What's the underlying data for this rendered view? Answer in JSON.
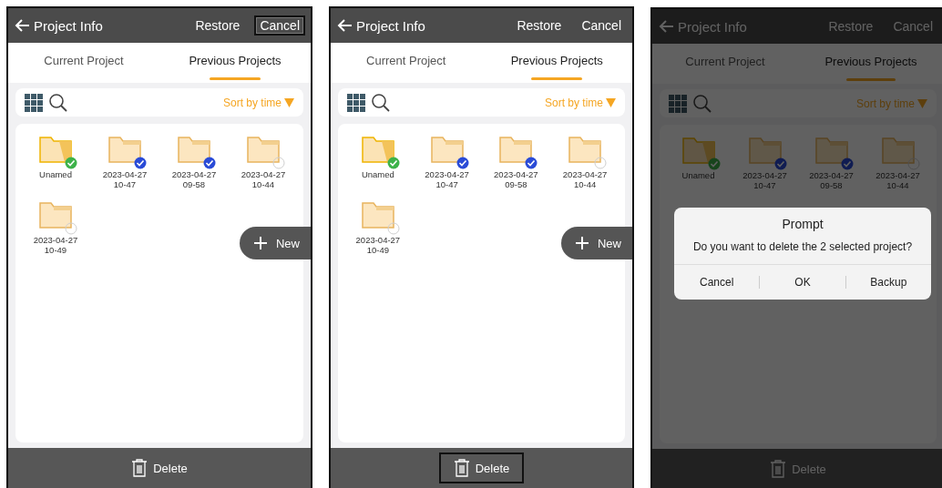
{
  "screens": [
    {
      "dimmed": false,
      "header": {
        "title": "Project Info",
        "actions": [
          {
            "label": "Restore",
            "highlighted": false
          },
          {
            "label": "Cancel",
            "highlighted": true
          }
        ]
      },
      "tabs": [
        {
          "label": "Current Project",
          "selected": false
        },
        {
          "label": "Previous Projects",
          "selected": true
        }
      ],
      "sort": "Sort by time",
      "projects": [
        {
          "lines": [
            "Unamed"
          ],
          "current": true,
          "checked": true
        },
        {
          "lines": [
            "2023-04-27",
            "10-47"
          ],
          "current": false,
          "checked": true
        },
        {
          "lines": [
            "2023-04-27",
            "09-58"
          ],
          "current": false,
          "checked": true
        },
        {
          "lines": [
            "2023-04-27",
            "10-44"
          ],
          "current": false,
          "checked": false
        },
        {
          "lines": [
            "2023-04-27",
            "10-49"
          ],
          "current": false,
          "checked": false
        }
      ],
      "new_button": "New",
      "delete_button": {
        "label": "Delete",
        "highlighted": false
      }
    },
    {
      "dimmed": false,
      "header": {
        "title": "Project Info",
        "actions": [
          {
            "label": "Restore",
            "highlighted": false
          },
          {
            "label": "Cancel",
            "highlighted": false
          }
        ]
      },
      "tabs": [
        {
          "label": "Current Project",
          "selected": false
        },
        {
          "label": "Previous Projects",
          "selected": true
        }
      ],
      "sort": "Sort by time",
      "projects": [
        {
          "lines": [
            "Unamed"
          ],
          "current": true,
          "checked": true
        },
        {
          "lines": [
            "2023-04-27",
            "10-47"
          ],
          "current": false,
          "checked": true
        },
        {
          "lines": [
            "2023-04-27",
            "09-58"
          ],
          "current": false,
          "checked": true
        },
        {
          "lines": [
            "2023-04-27",
            "10-44"
          ],
          "current": false,
          "checked": false
        },
        {
          "lines": [
            "2023-04-27",
            "10-49"
          ],
          "current": false,
          "checked": false
        }
      ],
      "new_button": "New",
      "delete_button": {
        "label": "Delete",
        "highlighted": true
      }
    },
    {
      "dimmed": true,
      "header": {
        "title": "Project Info",
        "actions": [
          {
            "label": "Restore",
            "highlighted": false
          },
          {
            "label": "Cancel",
            "highlighted": false
          }
        ]
      },
      "tabs": [
        {
          "label": "Current Project",
          "selected": false
        },
        {
          "label": "Previous Projects",
          "selected": true
        }
      ],
      "sort": "Sort by time",
      "projects": [
        {
          "lines": [
            "Unamed"
          ],
          "current": true,
          "checked": true
        },
        {
          "lines": [
            "2023-04-27",
            "10-47"
          ],
          "current": false,
          "checked": true
        },
        {
          "lines": [
            "2023-04-27",
            "09-58"
          ],
          "current": false,
          "checked": true
        },
        {
          "lines": [
            "2023-04-27",
            "10-44"
          ],
          "current": false,
          "checked": false
        }
      ],
      "delete_button": {
        "label": "Delete",
        "highlighted": false
      },
      "dialog": {
        "title": "Prompt",
        "message": "Do you want to delete the 2 selected project?",
        "buttons": [
          "Cancel",
          "OK",
          "Backup"
        ]
      }
    }
  ]
}
